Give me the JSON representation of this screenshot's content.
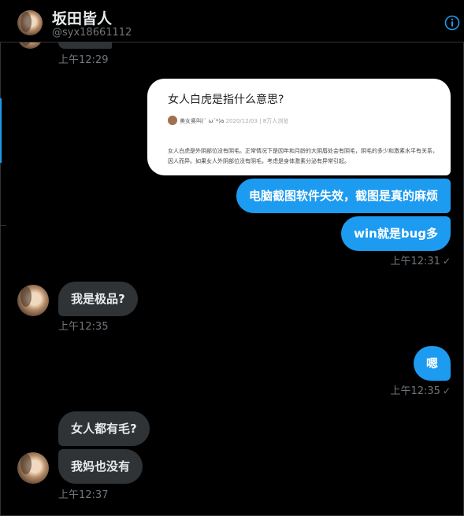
{
  "header": {
    "name": "坂田皆人",
    "handle": "@syx18661112"
  },
  "messages": {
    "peek_time": "上午12:29",
    "image_card": {
      "title": "女人白虎是指什么意思?",
      "author": "美女奥叫(` ω´*)a",
      "date": "2020/12/03",
      "reads": "8万人浏览",
      "body": "女人白虎是外阴部位没有阴毛。正常情况下是因年和月龄的大阴唇处会有阴毛，阴毛的多少和激素水平有关系，因人而异。如果女人外阴部位没有阴毛，考虑是身体激素分泌有异常引起。"
    },
    "sent1": "电脑截图软件失效，截图是真的麻烦",
    "sent2": "win就是bug多",
    "sent_time1": "上午12:31",
    "recv1": "我是极品?",
    "recv_time1": "上午12:35",
    "sent3": "嗯",
    "sent_time2": "上午12:35",
    "recv2": "女人都有毛?",
    "recv3": "我妈也没有",
    "recv_time2": "上午12:37"
  },
  "colors": {
    "accent": "#1d9bf0",
    "received_bubble": "#2f3336",
    "background": "#000000"
  },
  "icons": [
    "info-icon",
    "check-icon"
  ]
}
